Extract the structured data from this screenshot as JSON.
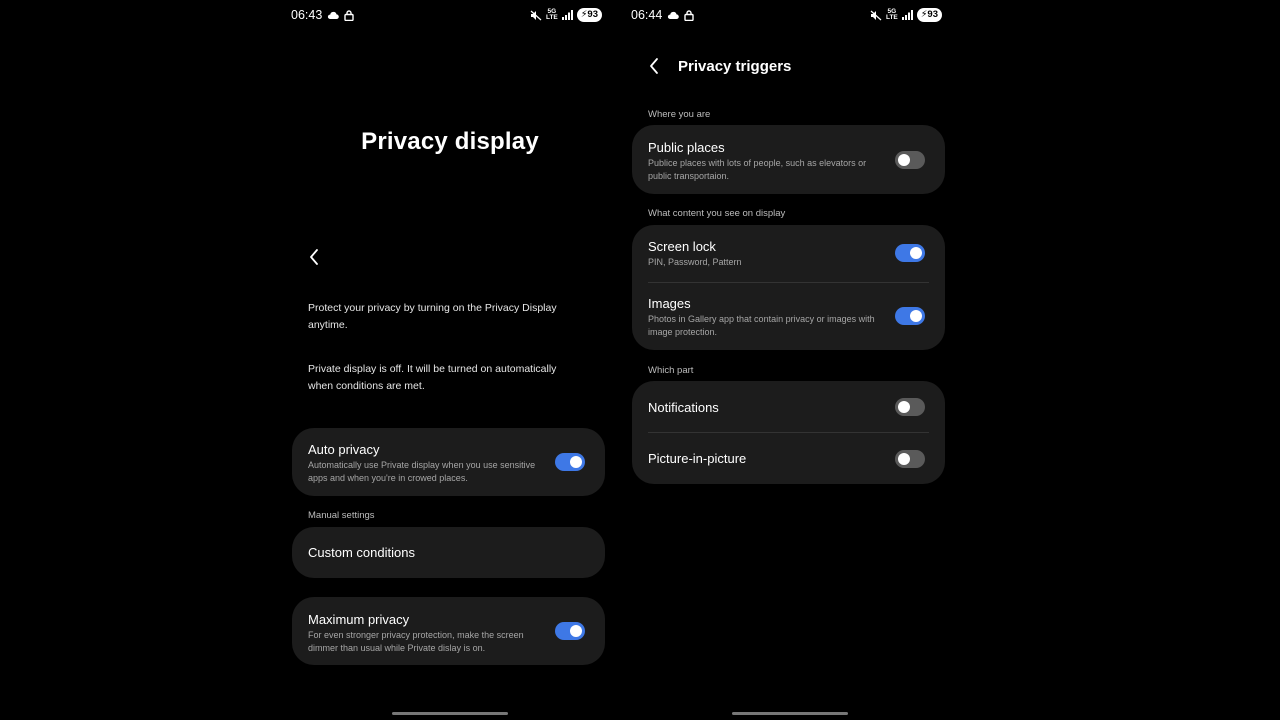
{
  "left": {
    "status": {
      "time": "06:43",
      "battery": "93",
      "net": "5G\nLTE"
    },
    "title": "Privacy display",
    "intro": "Protect your privacy by turning on the Privacy Display anytime.",
    "state": "Private display is off. It will be turned on automatically when conditions are met.",
    "auto_privacy": {
      "title": "Auto privacy",
      "desc": "Automatically use Private display when you use sensitive apps and when you're in crowed places.",
      "on": true
    },
    "manual_label": "Manual settings",
    "custom_conditions": "Custom conditions",
    "max_privacy": {
      "title": "Maximum privacy",
      "desc": "For even stronger privacy protection, make the screen dimmer than usual while Private dislay is on.",
      "on": true
    }
  },
  "right": {
    "status": {
      "time": "06:44",
      "battery": "93",
      "net": "5G\nLTE"
    },
    "title": "Privacy triggers",
    "section1": "Where you are",
    "public_places": {
      "title": "Public places",
      "desc": "Publice places with lots of people, such as elevators or public transportaion.",
      "on": false
    },
    "section2": "What content you see on display",
    "screen_lock": {
      "title": "Screen lock",
      "desc": "PIN, Password, Pattern",
      "on": true
    },
    "images": {
      "title": "Images",
      "desc": "Photos in Gallery app that contain privacy or images with image protection.",
      "on": true
    },
    "section3": "Which part",
    "notifications": {
      "title": "Notifications",
      "on": false
    },
    "pip": {
      "title": "Picture-in-picture",
      "on": false
    }
  },
  "colors": {
    "toggle_on": "#3e78e6",
    "toggle_off": "#5a5a5a",
    "card": "#1c1c1c"
  }
}
